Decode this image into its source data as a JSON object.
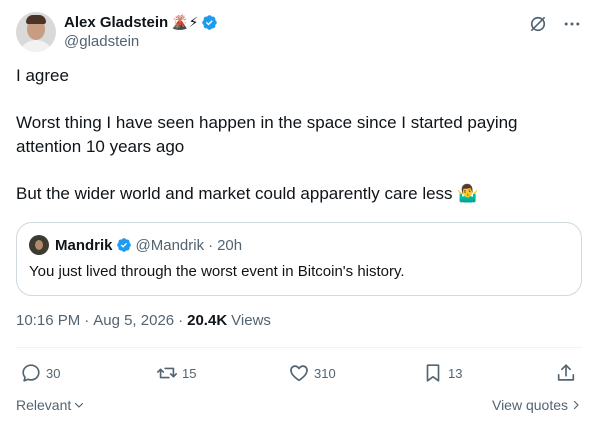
{
  "author": {
    "name": "Alex Gladstein",
    "emoji": "🌋⚡",
    "handle": "@gladstein"
  },
  "post": {
    "line1": "I agree",
    "line2": "Worst thing I have seen happen in the space since I started paying attention 10 years ago",
    "line3": "But the wider world and market could apparently care less 🤷‍♂️"
  },
  "quote": {
    "name": "Mandrik",
    "handle": "@Mandrik",
    "separator": "·",
    "age": "20h",
    "text": "You just lived through the worst event in Bitcoin's history."
  },
  "meta": {
    "time": "10:16 PM",
    "separator": "·",
    "date": "Aug 5, 2026",
    "views_count": "20.4K",
    "views_label": "Views"
  },
  "actions": {
    "replies": "30",
    "reposts": "15",
    "likes": "310",
    "bookmarks": "13"
  },
  "footer": {
    "sort_label": "Relevant",
    "view_quotes_label": "View quotes"
  },
  "colors": {
    "verified": "#1d9bf0",
    "text": "#0f1419",
    "secondary": "#536471",
    "border": "#cfd9de"
  }
}
